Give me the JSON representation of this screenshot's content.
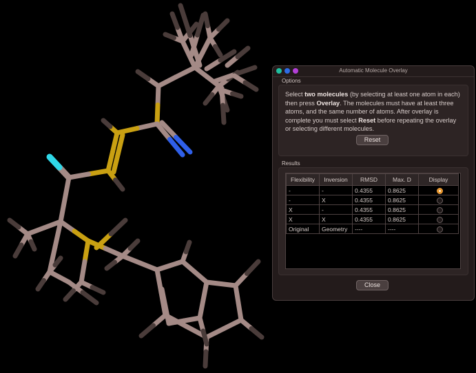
{
  "dialog": {
    "title": "Automatic Molecule Overlay",
    "traffic_colors": [
      "#1fbf9f",
      "#2e6ce6",
      "#b340d8"
    ],
    "options_label": "Options",
    "instructions": {
      "p1": "Select ",
      "b1": "two molecules",
      "p2": " (by selecting at least one atom in each) then press ",
      "b2": "Overlay",
      "p3": ". The molecules must have at least three atoms, and the same number of atoms. After overlay is complete you must select ",
      "b3": "Reset",
      "p4": " before repeating the overlay or selecting different molecules."
    },
    "reset_label": "Reset",
    "results_label": "Results",
    "columns": [
      "Flexibility",
      "Inversion",
      "RMSD",
      "Max. D",
      "Display"
    ],
    "rows": [
      {
        "flexibility": "-",
        "inversion": "-",
        "rmsd": "0.4355",
        "maxd": "0.8625",
        "selected": true
      },
      {
        "flexibility": "-",
        "inversion": "X",
        "rmsd": "0.4355",
        "maxd": "0.8625",
        "selected": false
      },
      {
        "flexibility": "X",
        "inversion": "-",
        "rmsd": "0.4355",
        "maxd": "0.8625",
        "selected": false
      },
      {
        "flexibility": "X",
        "inversion": "X",
        "rmsd": "0.4355",
        "maxd": "0.8625",
        "selected": false
      },
      {
        "flexibility": "Original",
        "inversion": "Geometry",
        "rmsd": "----",
        "maxd": "----",
        "selected": false
      }
    ],
    "close_label": "Close"
  },
  "colors": {
    "carbon": "#a48a86",
    "hydrogen": "#4a3c3a",
    "sulfur": "#c9a012",
    "nitrogen": "#2f5fe8",
    "fluorine": "#2fd8e8",
    "accent": "#e58f1e"
  }
}
